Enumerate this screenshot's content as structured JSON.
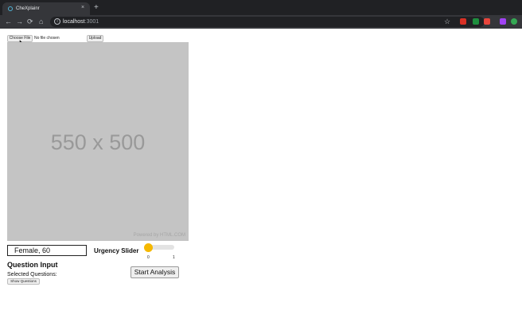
{
  "browser": {
    "tab_title": "CheXplainr",
    "tab_close": "×",
    "new_tab": "+",
    "url_host": "localhost",
    "url_port": ":3001",
    "extension_colors": [
      "#d93025",
      "#1e8e3e",
      "#e8453c",
      "#a142f4",
      "#34a853"
    ]
  },
  "upload": {
    "choose_file_label": "Choose File",
    "file_status": "No file chosen",
    "upload_label": "Upload"
  },
  "image_placeholder": {
    "text": "550 x 500",
    "credit": "Powered by HTML.COM"
  },
  "patient": {
    "value": "Female, 60"
  },
  "urgency": {
    "label": "Urgency Slider",
    "min_label": "0",
    "max_label": "1",
    "value": 0
  },
  "questions": {
    "title": "Question Input",
    "selected_label": "Selected Questions:",
    "show_button": "Show Questions"
  },
  "actions": {
    "start_analysis": "Start Analysis"
  },
  "colors": {
    "slider_thumb": "#f5b800",
    "placeholder_bg": "#c4c4c4"
  }
}
